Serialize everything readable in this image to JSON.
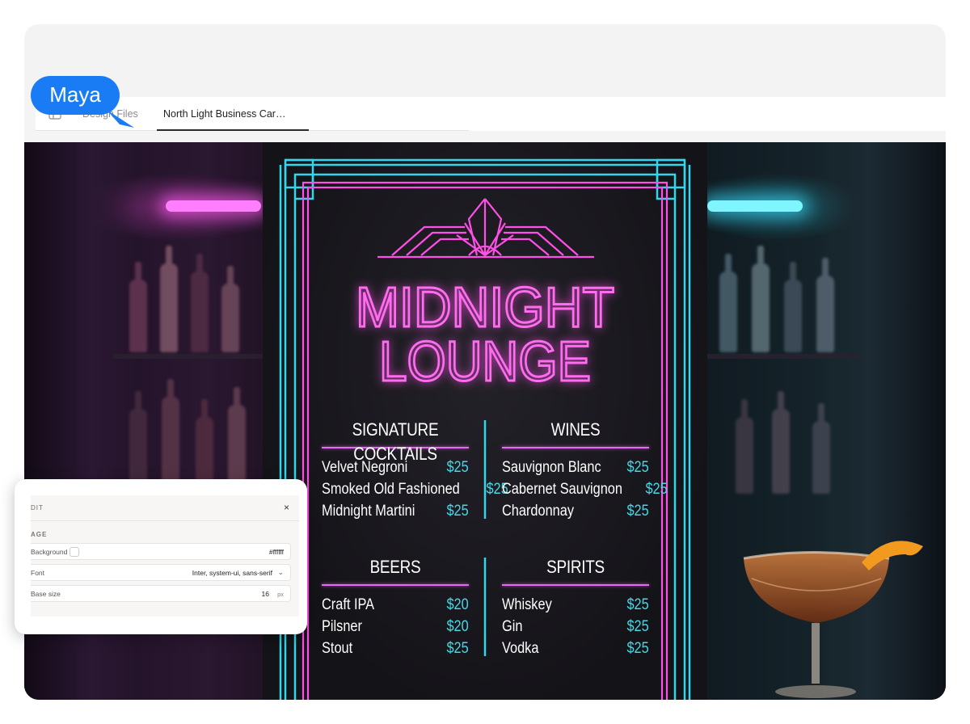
{
  "tabs": {
    "design_files": "Design Files",
    "active": "North Light Business Car…"
  },
  "collaborator": {
    "name": "Maya",
    "color": "#1a7cf5"
  },
  "menu": {
    "title_line1": "MIDNIGHT",
    "title_line2": "LOUNGE",
    "accent_pink": "#ff4fe6",
    "accent_cyan": "#33d6ea",
    "sections": [
      {
        "heading": "SIGNATURE COCKTAILS",
        "items": [
          {
            "name": "Velvet Negroni",
            "price": "$25"
          },
          {
            "name": "Smoked Old Fashioned",
            "price": "$25"
          },
          {
            "name": "Midnight Martini",
            "price": "$25"
          }
        ]
      },
      {
        "heading": "WINES",
        "items": [
          {
            "name": "Sauvignon Blanc",
            "price": "$25"
          },
          {
            "name": "Cabernet Sauvignon",
            "price": "$25"
          },
          {
            "name": "Chardonnay",
            "price": "$25"
          }
        ]
      },
      {
        "heading": "BEERS",
        "items": [
          {
            "name": "Craft IPA",
            "price": "$20"
          },
          {
            "name": "Pilsner",
            "price": "$20"
          },
          {
            "name": "Stout",
            "price": "$25"
          }
        ]
      },
      {
        "heading": "SPIRITS",
        "items": [
          {
            "name": "Whiskey",
            "price": "$25"
          },
          {
            "name": "Gin",
            "price": "$25"
          },
          {
            "name": "Vodka",
            "price": "$25"
          }
        ]
      }
    ]
  },
  "edit_panel": {
    "title": "DIT",
    "close": "×",
    "section": "AGE",
    "background_label": "Background",
    "background_value": "#ffffff",
    "font_label": "Font",
    "font_value": "Inter, system-ui, sans-serif",
    "base_size_label": "Base size",
    "base_size_value": "16",
    "base_size_unit": "px"
  }
}
